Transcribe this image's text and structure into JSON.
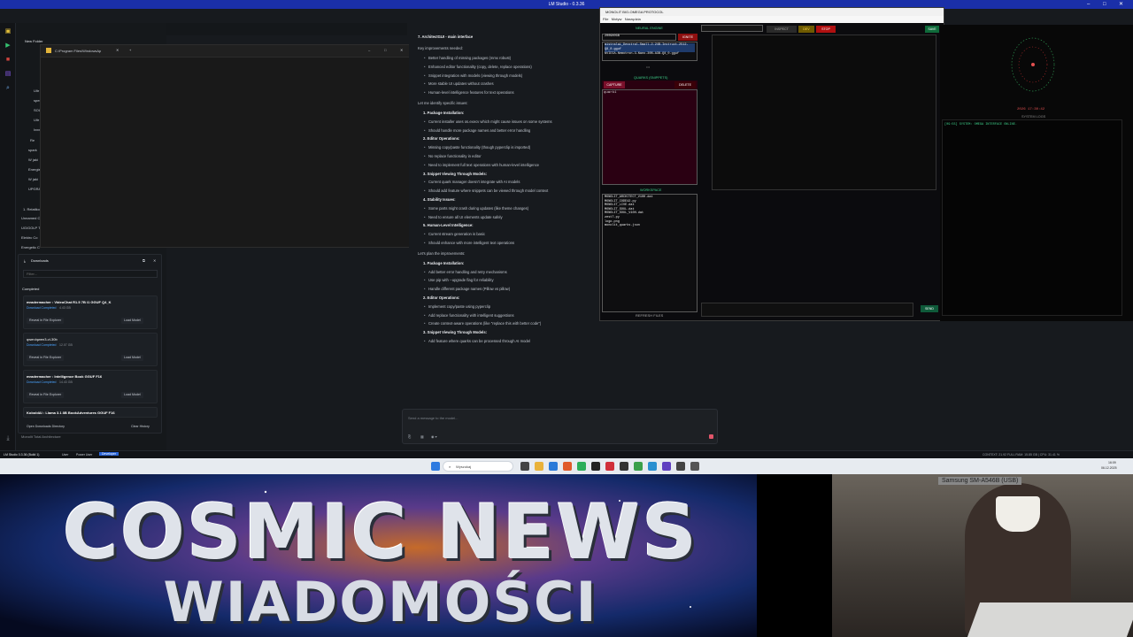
{
  "window": {
    "title": "LM Studio - 0.3.36"
  },
  "tabs": {
    "chat_tab": "Unnamed Chat"
  },
  "sidebar": {
    "header": "Chats",
    "folder": "New Folder",
    "items": [
      "Ultr",
      "spee",
      "SOUL",
      "Ultr",
      "Ixxx",
      "Re",
      "spark",
      "W jaki",
      "Energie",
      "W jaki",
      "UPGRA"
    ],
    "more_items": [
      "1. Relatikon",
      "Unnamed C",
      "UG/GOLP T",
      "Elektrc Co",
      "Energetic C"
    ],
    "footer": "Monolit Total Architecture"
  },
  "explorer": {
    "title": "C:\\Program Files\\WindowsAp"
  },
  "downloads": {
    "title": "Downloads",
    "filter_placeholder": "Filter...",
    "section": "Completed",
    "items": [
      {
        "name": "mradermacher : VideoChat R1.5 7B i1 GGUF Q4_K",
        "status": "Download Completed",
        "size": "4.43 GB",
        "reveal": "Reveal in File Explorer",
        "load": "Load Model"
      },
      {
        "name": "qwen/qwen3-vl-30b",
        "status": "Download Completed",
        "size": "12.07 GB",
        "reveal": "Reveal in File Explorer",
        "load": "Load Model"
      },
      {
        "name": "mradermacher : Intelligence Book GGUF F16",
        "status": "Download Completed",
        "size": "14.43 GB",
        "reveal": "Reveal in File Explorer",
        "load": "Load Model"
      },
      {
        "name": "KoboldAI : Llama 3.1 8B BookAdventures GGUF F16",
        "status": "",
        "size": "",
        "reveal": "",
        "load": ""
      }
    ],
    "open_dir": "Open Downloads Directory",
    "clear": "Clear History"
  },
  "chat": {
    "lines": [
      {
        "t": "7. ArchitectGUI - main interface",
        "k": "h"
      },
      {
        "t": "Key improvements needed:",
        "k": "p"
      },
      {
        "t": "Better handling of missing packages (mmx robust)",
        "k": "b"
      },
      {
        "t": "Enhanced editor functionality (copy, delete, replace operations)",
        "k": "b"
      },
      {
        "t": "Snippet integration with models (viewing through models)",
        "k": "b"
      },
      {
        "t": "More stable UI updates without crashes",
        "k": "b"
      },
      {
        "t": "Human-level intelligence features for text operations",
        "k": "b"
      },
      {
        "t": "Let me identify specific issues:",
        "k": "p"
      },
      {
        "t": "1. Package Installation:",
        "k": "h2"
      },
      {
        "t": "Current installer uses  os.execv  which might cause issues on some systems",
        "k": "b"
      },
      {
        "t": "Should handle more package names and better error handling",
        "k": "b"
      },
      {
        "t": "2. Editor Operations:",
        "k": "h2"
      },
      {
        "t": "Missing copy/paste functionality (though pyperclip is imported)",
        "k": "b"
      },
      {
        "t": "No replace functionality in editor",
        "k": "b"
      },
      {
        "t": "Need to implement full text operations with human-level intelligence",
        "k": "b"
      },
      {
        "t": "3. Snippet Viewing Through Models:",
        "k": "h2"
      },
      {
        "t": "Current quark manager doesn't integrate with AI models",
        "k": "b"
      },
      {
        "t": "Should add feature where snippets can be viewed through model context",
        "k": "b"
      },
      {
        "t": "4. Stability Issues:",
        "k": "h2"
      },
      {
        "t": "Some parts might crash during updates (like theme changes)",
        "k": "b"
      },
      {
        "t": "Need to ensure all UI elements update safely",
        "k": "b"
      },
      {
        "t": "5. Human-Level Intelligence:",
        "k": "h2"
      },
      {
        "t": "Current stream generation is basic",
        "k": "b"
      },
      {
        "t": "Should enhance with more intelligent text operations",
        "k": "b"
      },
      {
        "t": "Let's plan the improvements:",
        "k": "p"
      },
      {
        "t": "1. Package Installation:",
        "k": "h2"
      },
      {
        "t": "Add better error handling and retry mechanisms",
        "k": "b"
      },
      {
        "t": "Use pip with --upgrade flag for reliability",
        "k": "b"
      },
      {
        "t": "Handle different package names (Pillow vs pillow)",
        "k": "b"
      },
      {
        "t": "2. Editor Operations:",
        "k": "h2"
      },
      {
        "t": "Implement copy/paste using pyperclip",
        "k": "b"
      },
      {
        "t": "Add replace functionality with intelligent suggestions",
        "k": "b"
      },
      {
        "t": "Create context-aware operations (like \"replace this with better code\")",
        "k": "b"
      },
      {
        "t": "3. Snippet Viewing Through Models:",
        "k": "h2"
      },
      {
        "t": "Add feature where quarks can be processed through AI model",
        "k": "b"
      }
    ],
    "composer_placeholder": "Send a message to the model..."
  },
  "statusbar": {
    "app": "LM Studio 0.3.36 (Build 1)",
    "modes": [
      "User",
      "Power User",
      "Developer"
    ],
    "right": "CONTEXT: 21.92 FULL   RAM: 15.85 GB | CPU: 31.41 %"
  },
  "taskbar": {
    "search": "Wyszukaj",
    "device": "Samsung SM-A546B (USB)",
    "clock": "16:09",
    "date": "06.12.2025"
  },
  "protocol": {
    "title": "MONOLIT BIO-OMEGA PROTOCOL",
    "menu": [
      "File",
      "Motyw",
      "Narzędzia"
    ],
    "neural_engine": "NEURAL ENGINE",
    "ignite": "IGNITE",
    "model_path": "200980GB",
    "model_list": [
      "mistralai_Devstral-Small-2-24B-Instruct-2512-Q8_0.gguf",
      "NVIDIA-Nemotron-3-Nano-30B-A3B-Q8_0.gguf"
    ],
    "dots": "•••",
    "capture": "CAPTURE",
    "delete": "DELETE",
    "quarks": "QUARKS (SNIPPETS)",
    "quark_item": "quark1",
    "workspace": "WORKSPACE",
    "files": [
      "MONOLIT_ARCHITECT_V10H.dat",
      "MONOLIT_CODE42.py",
      "MONOLIT_LIVE.dat",
      "MONOLIT_SOUL.dat",
      "MONOLIT_SOUL_V10H.dat",
      "zest7.py",
      "logo.png",
      "monolit_quarks.json"
    ],
    "refresh": "REFRESH FILES",
    "inspect": "INSPECT",
    "dev": "DEV",
    "stop": "STOP",
    "save": "SAVE",
    "send": "SEND"
  },
  "right": {
    "clock": "2026 17:30:42",
    "system_logs": "SYSTEM LOGS",
    "log_line": "[09:55] SYSTEM: OMEGA INTERFACE ONLINE."
  },
  "banner": {
    "line1": "COSMIC NEWS",
    "line2": "WIADOMOŚCI"
  },
  "colors": {
    "accent": "#3fd08a",
    "danger": "#8e1010",
    "brand": "#1a2fa8"
  }
}
